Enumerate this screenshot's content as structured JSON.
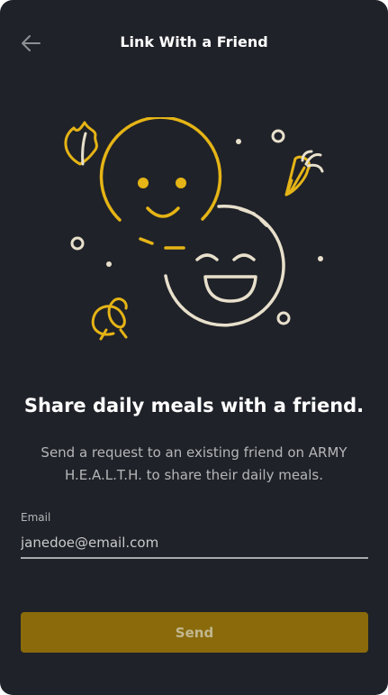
{
  "header": {
    "title": "Link With a Friend",
    "back_icon": "arrow-left-icon"
  },
  "content": {
    "headline": "Share daily meals with a friend.",
    "description": "Send a request to an existing friend on ARMY H.E.A.L.T.H. to share their daily meals."
  },
  "form": {
    "email_label": "Email",
    "email_value": "janedoe@email.com"
  },
  "actions": {
    "send_label": "Send"
  },
  "colors": {
    "background": "#1f2228",
    "accent_gold": "#e5b416",
    "illustration_cream": "#e8e0cc",
    "button_bg": "#8a6a0b",
    "button_text": "#c2b78f"
  }
}
